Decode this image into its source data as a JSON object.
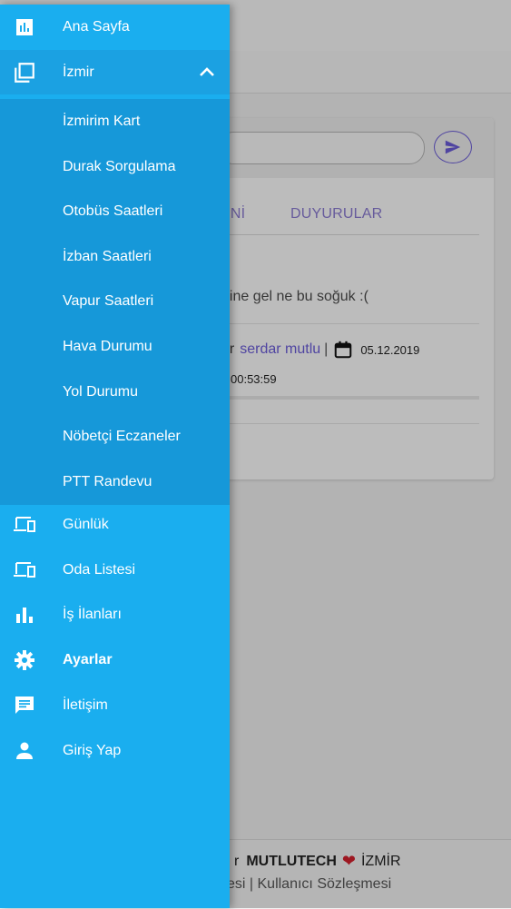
{
  "background": {
    "tabs": [
      "ENİ",
      "DUYURULAR"
    ],
    "post": {
      "text": "dine gel ne bu soğuk :(",
      "author_prefix": "ar",
      "author": "serdar mutlu",
      "separator": "|",
      "date": "05.12.2019",
      "time": "00:53:59"
    },
    "footer": {
      "line1_prefix": "r",
      "brand": "MUTLUTECH",
      "city": "İZMİR",
      "line2": "esi | Kullanıcı Sözleşmesi"
    },
    "accent_color": "#6a5bd7"
  },
  "drawer": {
    "background_color": "#1aaeef",
    "items": [
      {
        "label": "Ana Sayfa",
        "icon": "bar-chart-icon"
      },
      {
        "label": "İzmir",
        "icon": "collection-icon",
        "expanded": true
      },
      {
        "label": "Günlük",
        "icon": "devices-icon"
      },
      {
        "label": "Oda Listesi",
        "icon": "devices-icon"
      },
      {
        "label": "İş İlanları",
        "icon": "bar-chart-icon"
      },
      {
        "label": "Ayarlar",
        "icon": "gear-icon"
      },
      {
        "label": "İletişim",
        "icon": "chat-icon"
      },
      {
        "label": "Giriş Yap",
        "icon": "person-icon"
      }
    ],
    "submenu": [
      {
        "label": "İzmirim Kart"
      },
      {
        "label": "Durak Sorgulama"
      },
      {
        "label": "Otobüs Saatleri"
      },
      {
        "label": "İzban Saatleri"
      },
      {
        "label": "Vapur Saatleri"
      },
      {
        "label": "Hava Durumu"
      },
      {
        "label": "Yol Durumu"
      },
      {
        "label": "Nöbetçi Eczaneler"
      },
      {
        "label": "PTT Randevu"
      }
    ]
  }
}
